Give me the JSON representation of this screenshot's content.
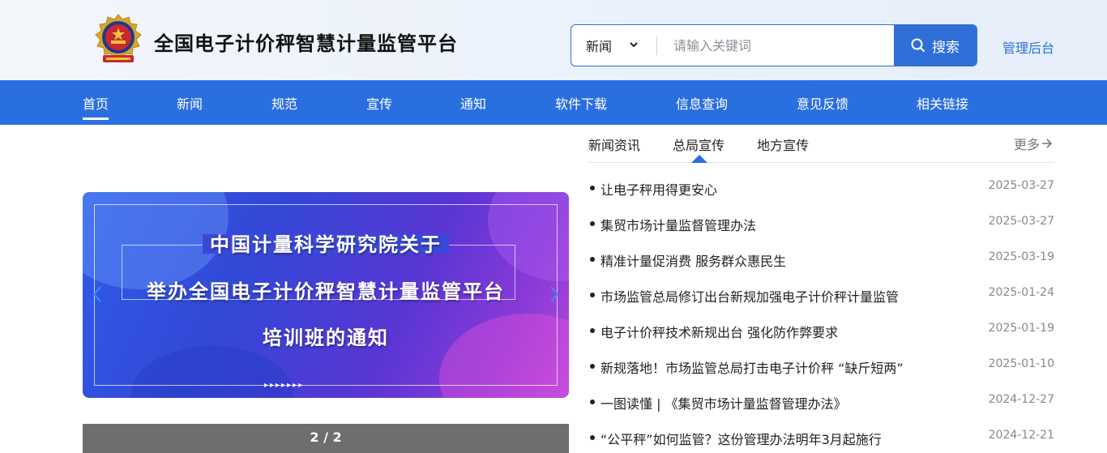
{
  "header": {
    "site_title": "全国电子计价秤智慧计量监管平台",
    "emblem_icon": "police-emblem-icon",
    "search": {
      "category": "新闻",
      "placeholder": "请输入关键词",
      "button_label": "搜索"
    },
    "admin_link": "管理后台"
  },
  "nav": {
    "items": [
      {
        "label": "首页",
        "active": true
      },
      {
        "label": "新闻"
      },
      {
        "label": "规范"
      },
      {
        "label": "宣传"
      },
      {
        "label": "通知"
      },
      {
        "label": "软件下载"
      },
      {
        "label": "信息查询"
      },
      {
        "label": "意见反馈"
      },
      {
        "label": "相关链接"
      }
    ]
  },
  "banner": {
    "line1": "中国计量科学研究院关于",
    "line2": "举办全国电子计价秤智慧计量监管平台",
    "line3": "培训班的通知",
    "arrows": "▸▸▸▸▸▸▸",
    "pager": "2 / 2"
  },
  "news": {
    "tabs": [
      {
        "label": "新闻资讯"
      },
      {
        "label": "总局宣传",
        "active": true
      },
      {
        "label": "地方宣传"
      }
    ],
    "more_label": "更多",
    "items": [
      {
        "title": "让电子秤用得更安心",
        "date": "2025-03-27"
      },
      {
        "title": "集贸市场计量监督管理办法",
        "date": "2025-03-27"
      },
      {
        "title": "精准计量促消费 服务群众惠民生",
        "date": "2025-03-19"
      },
      {
        "title": "市场监管总局修订出台新规加强电子计价秤计量监管",
        "date": "2025-01-24"
      },
      {
        "title": "电子计价秤技术新规出台 强化防作弊要求",
        "date": "2025-01-19"
      },
      {
        "title": "新规落地！市场监管总局打击电子计价秤 “缺斤短两”",
        "date": "2025-01-10"
      },
      {
        "title": "一图读懂 | 《集贸市场计量监督管理办法》",
        "date": "2024-12-27"
      },
      {
        "title": "“公平秤”如何监管？这份管理办法明年3月起施行",
        "date": "2024-12-21"
      }
    ]
  },
  "colors": {
    "primary": "#2a6fe0",
    "nav_bg": "#2a6fe0",
    "pager_bg": "#6e6e6e"
  }
}
